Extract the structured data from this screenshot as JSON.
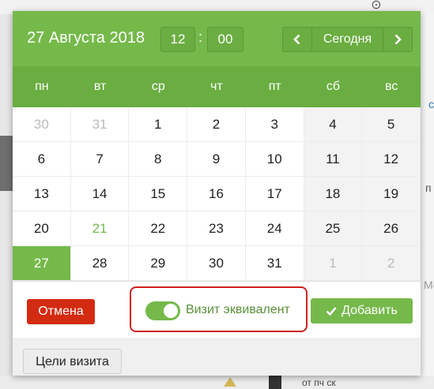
{
  "header": {
    "date_title": "27 Августа 2018",
    "hour": "12",
    "separator": ":",
    "minute": "00",
    "today_label": "Сегодня"
  },
  "weekdays": [
    "пн",
    "вт",
    "ср",
    "чт",
    "пт",
    "сб",
    "вс"
  ],
  "weeks": [
    [
      "30",
      "31",
      "1",
      "2",
      "3",
      "4",
      "5"
    ],
    [
      "6",
      "7",
      "8",
      "9",
      "10",
      "11",
      "12"
    ],
    [
      "13",
      "14",
      "15",
      "16",
      "17",
      "18",
      "19"
    ],
    [
      "20",
      "21",
      "22",
      "23",
      "24",
      "25",
      "26"
    ],
    [
      "27",
      "28",
      "29",
      "30",
      "31",
      "1",
      "2"
    ]
  ],
  "footer": {
    "cancel_label": "Отмена",
    "toggle_label": "Визит эквивалент",
    "add_label": "Добавить"
  },
  "bottom": {
    "goals_label": "Цели визита"
  },
  "background": {
    "right_fragments": [
      "с",
      "п",
      "Ме"
    ],
    "bottom_text": "от пч ск"
  },
  "colors": {
    "accent": "#75b94a",
    "accent_dark": "#6aad41",
    "danger": "#d32b12",
    "highlight": "#d12020"
  }
}
